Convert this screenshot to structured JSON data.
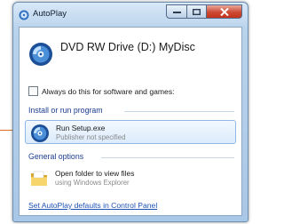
{
  "window": {
    "title": "AutoPlay",
    "icon": "autoplay-icon",
    "controls": [
      "minimize-icon",
      "maximize-icon",
      "close-icon"
    ]
  },
  "header": {
    "drive_title": "DVD RW Drive (D:) MyDisc",
    "icon": "dvd-disc-icon"
  },
  "always_checkbox": {
    "label": "Always do this for software and games:",
    "checked": false
  },
  "install_group": {
    "heading": "Install or run program",
    "items": [
      {
        "title": "Run Setup.exe",
        "subtitle": "Publisher not specified",
        "icon": "setup-disc-icon",
        "selected": true
      }
    ]
  },
  "general_group": {
    "heading": "General options",
    "items": [
      {
        "title": "Open folder to view files",
        "subtitle": "using Windows Explorer",
        "icon": "folder-icon",
        "selected": false
      }
    ]
  },
  "footer": {
    "link": "Set AutoPlay defaults in Control Panel"
  },
  "colors": {
    "accent_heading": "#1b3d8f",
    "link": "#1f53b8",
    "callout": "#e07020",
    "close_button": "#c3321c"
  }
}
